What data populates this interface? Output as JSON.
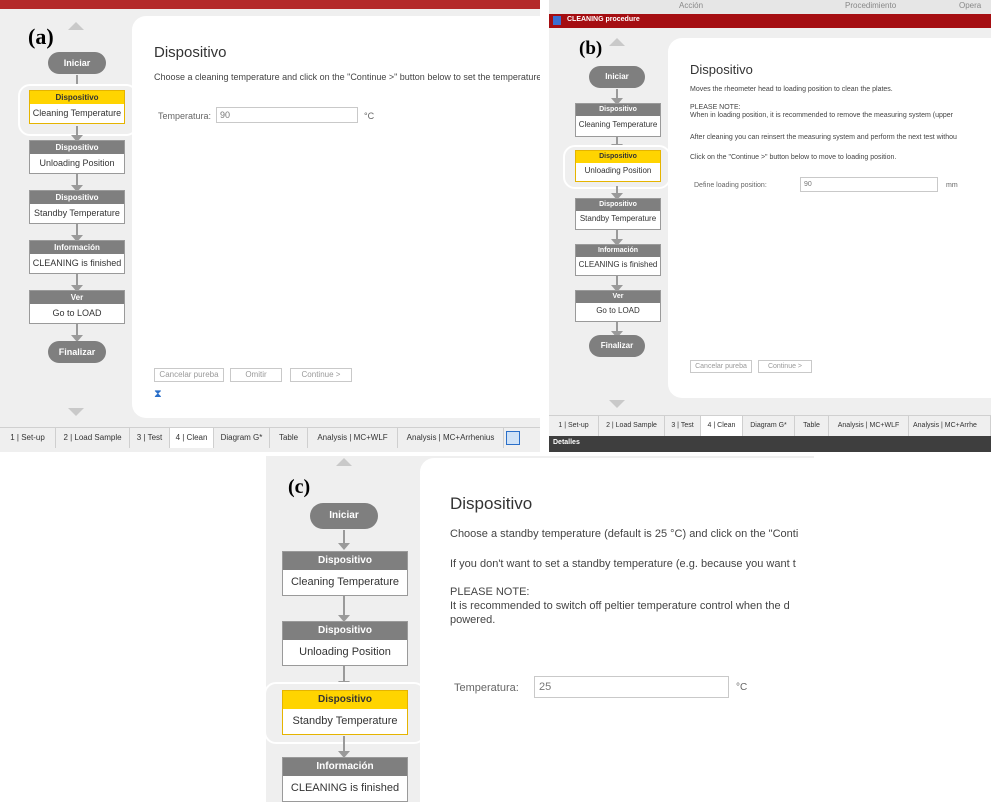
{
  "panels": {
    "a": {
      "label": "(a)",
      "steps": {
        "start": "Iniciar",
        "s1_head": "Dispositivo",
        "s1_body": "Cleaning Temperature",
        "s2_head": "Dispositivo",
        "s2_body": "Unloading Position",
        "s3_head": "Dispositivo",
        "s3_body": "Standby Temperature",
        "s4_head": "Información",
        "s4_body": "CLEANING is finished",
        "s5_head": "Ver",
        "s5_body": "Go to LOAD",
        "end": "Finalizar"
      },
      "title": "Dispositivo",
      "instruction": "Choose a cleaning temperature and click on the \"Continue >\" button below to set the temperature!",
      "field_label": "Temperatura:",
      "field_value": "90",
      "field_unit": "°C",
      "buttons": {
        "cancel": "Cancelar pureba",
        "skip": "Omitir",
        "continue": "Continue >"
      },
      "tabs": [
        "1 | Set-up",
        "2 | Load Sample",
        "3 | Test",
        "4 | Clean",
        "Diagram G*",
        "Table",
        "Analysis | MC+WLF",
        "Analysis | MC+Arrhenius"
      ]
    },
    "b": {
      "label": "(b)",
      "header_top": [
        "Acción",
        "Procedimiento",
        "Opera"
      ],
      "window_title": "CLEANING procedure",
      "steps": {
        "start": "Iniciar",
        "s1_head": "Dispositivo",
        "s1_body": "Cleaning Temperature",
        "s2_head": "Dispositivo",
        "s2_body": "Unloading Position",
        "s3_head": "Dispositivo",
        "s3_body": "Standby Temperature",
        "s4_head": "Información",
        "s4_body": "CLEANING is finished",
        "s5_head": "Ver",
        "s5_body": "Go to LOAD",
        "end": "Finalizar"
      },
      "title": "Dispositivo",
      "line1": "Moves the rheometer head to loading position to clean the plates.",
      "note_head": "PLEASE NOTE:",
      "note_body": "When in loading position, it is recommended to remove the measuring system (upper",
      "line3": "After cleaning you can reinsert the measuring system and perform the next test withou",
      "line4": "Click on the \"Continue >\" button below to move to loading position.",
      "field_label": "Define loading position:",
      "field_value": "90",
      "field_unit": "mm",
      "buttons": {
        "cancel": "Cancelar pureba",
        "continue": "Continue >"
      },
      "tabs": [
        "1 | Set-up",
        "2 | Load Sample",
        "3 | Test",
        "4 | Clean",
        "Diagram G*",
        "Table",
        "Analysis | MC+WLF",
        "Analysis | MC+Arrhe"
      ],
      "footer": "Detalles"
    },
    "c": {
      "label": "(c)",
      "steps": {
        "start": "Iniciar",
        "s1_head": "Dispositivo",
        "s1_body": "Cleaning Temperature",
        "s2_head": "Dispositivo",
        "s2_body": "Unloading Position",
        "s3_head": "Dispositivo",
        "s3_body": "Standby Temperature",
        "s4_head": "Información",
        "s4_body": "CLEANING is finished"
      },
      "title": "Dispositivo",
      "line1": "Choose a standby temperature (default is 25 °C) and click on the \"Conti",
      "line2": "If you don't want to set a standby temperature (e.g. because you want t",
      "note_head": "PLEASE NOTE:",
      "note_body1": "It is recommended to switch off peltier temperature control when the d",
      "note_body2": "powered.",
      "field_label": "Temperatura:",
      "field_value": "25",
      "field_unit": "°C"
    }
  },
  "colors": {
    "active_step": "#ffd400",
    "step_header": "#7f7f7f",
    "window_title_bar": "#a50e12",
    "tab_bar": "#efefef"
  }
}
